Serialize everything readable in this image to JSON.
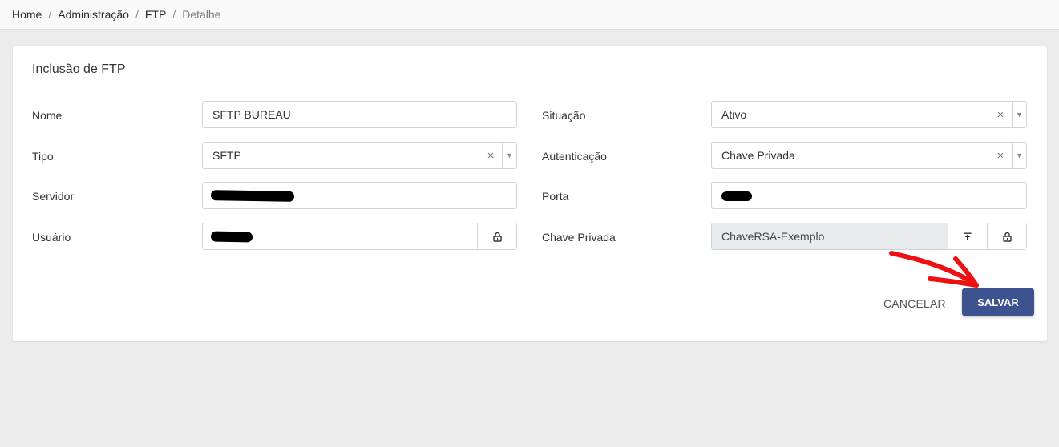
{
  "breadcrumb": {
    "items": [
      "Home",
      "Administração",
      "FTP"
    ],
    "current": "Detalhe",
    "separator": "/"
  },
  "form": {
    "title": "Inclusão de FTP",
    "nome": {
      "label": "Nome",
      "value": "SFTP BUREAU"
    },
    "tipo": {
      "label": "Tipo",
      "value": "SFTP"
    },
    "servidor": {
      "label": "Servidor",
      "value": ""
    },
    "usuario": {
      "label": "Usuário",
      "value": ""
    },
    "situacao": {
      "label": "Situação",
      "value": "Ativo"
    },
    "autenticacao": {
      "label": "Autenticação",
      "value": "Chave Privada"
    },
    "porta": {
      "label": "Porta",
      "value": ""
    },
    "chave_privada": {
      "label": "Chave Privada",
      "value": "ChaveRSA-Exemplo"
    }
  },
  "actions": {
    "cancel_label": "CANCELAR",
    "save_label": "SALVAR"
  },
  "icons": {
    "clear": "×",
    "caret": "▼",
    "lock": "lock-icon",
    "upload": "upload-icon"
  },
  "colors": {
    "primary": "#3d5390",
    "annotation_arrow": "#ee1111"
  }
}
